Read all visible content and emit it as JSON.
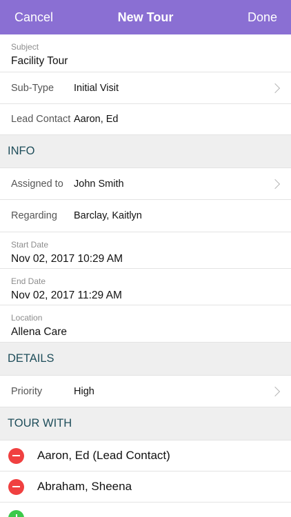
{
  "navbar": {
    "cancel_label": "Cancel",
    "title": "New Tour",
    "done_label": "Done",
    "bar_color": "#8a6fd3"
  },
  "subject": {
    "label": "Subject",
    "value": "Facility Tour"
  },
  "sub_type": {
    "label": "Sub-Type",
    "value": "Initial Visit"
  },
  "lead_contact": {
    "label": "Lead Contact",
    "value": "Aaron, Ed"
  },
  "info_section": {
    "title": "INFO"
  },
  "assigned_to": {
    "label": "Assigned to",
    "value": "John Smith"
  },
  "regarding": {
    "label": "Regarding",
    "value": "Barclay, Kaitlyn"
  },
  "start_date": {
    "label": "Start Date",
    "value": "Nov 02, 2017 10:29 AM"
  },
  "end_date": {
    "label": "End Date",
    "value": "Nov 02, 2017 11:29 AM"
  },
  "location": {
    "label": "Location",
    "value": "Allena Care"
  },
  "details_section": {
    "title": "DETAILS"
  },
  "priority": {
    "label": "Priority",
    "value": "High"
  },
  "tour_with_section": {
    "title": "TOUR WITH"
  },
  "tour_with": [
    {
      "name": "Aaron, Ed (Lead Contact)",
      "icon": "remove-icon"
    },
    {
      "name": "Abraham, Sheena",
      "icon": "remove-icon"
    }
  ],
  "add_icon": "add-icon"
}
